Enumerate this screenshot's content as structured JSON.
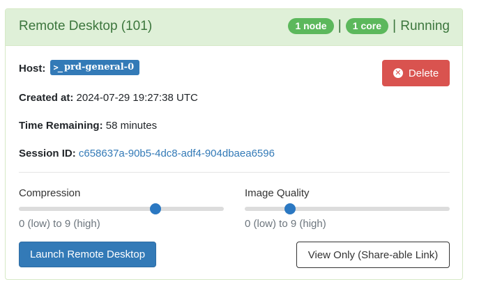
{
  "card": {
    "title": "Remote Desktop (101)",
    "nodes_badge": "1 node",
    "cores_badge": "1 core",
    "separator": "|",
    "status": "Running"
  },
  "details": {
    "host_label": "Host:",
    "host_value": "prd-general-0",
    "host_icon": ">_",
    "created_label": "Created at:",
    "created_value": "2024-07-29 19:27:38 UTC",
    "remaining_label": "Time Remaining:",
    "remaining_value": "58 minutes",
    "session_label": "Session ID:",
    "session_value": "c658637a-90b5-4dc8-adf4-904dbaea6596"
  },
  "delete_button": {
    "label": "Delete",
    "icon": "x-circle-icon",
    "color": "#d9534f"
  },
  "sliders": {
    "compression": {
      "label": "Compression",
      "hint": "0 (low) to 9 (high)",
      "value": 6,
      "min": 0,
      "max": 9
    },
    "image_quality": {
      "label": "Image Quality",
      "hint": "0 (low) to 9 (high)",
      "value": 2,
      "min": 0,
      "max": 9
    }
  },
  "buttons": {
    "launch": "Launch Remote Desktop",
    "view_only": "View Only (Share-able Link)"
  },
  "colors": {
    "header_bg": "#dff0d8",
    "header_text": "#3c763d",
    "badge_green": "#5cb85c",
    "primary": "#337ab7",
    "danger": "#d9534f"
  }
}
